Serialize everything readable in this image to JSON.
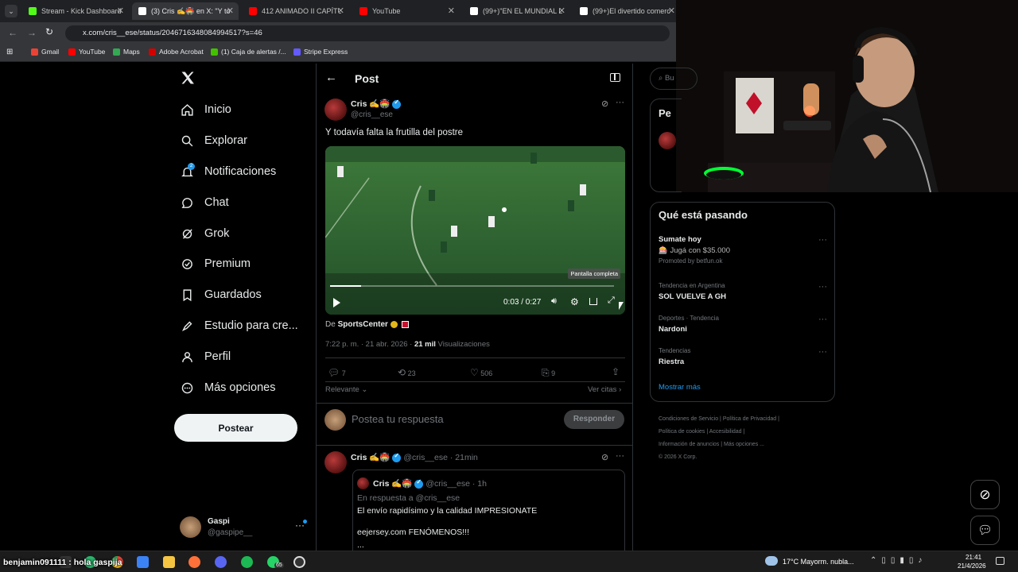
{
  "browser": {
    "tabs": [
      {
        "title": "Stream - Kick Dashboard",
        "color": "#53fc18"
      },
      {
        "title": "(3) Cris ✍️🏟️ en X: \"Y tod",
        "color": "#ffffff"
      },
      {
        "title": "412 ANIMADO II CAPÍTUL",
        "color": "#ff0000"
      },
      {
        "title": "YouTube",
        "color": "#ff0000"
      },
      {
        "title": "(99+)\"EN EL MUNDIAL LE",
        "color": "#ffffff"
      },
      {
        "title": "(99+)El divertido comerc",
        "color": "#ffffff"
      }
    ],
    "url": "x.com/cris__ese/status/2046716348084994517?s=46",
    "bookmarks": [
      {
        "label": "Gmail",
        "color": "#ea4335"
      },
      {
        "label": "YouTube",
        "color": "#ff0000"
      },
      {
        "label": "Maps",
        "color": "#34a853"
      },
      {
        "label": "Adobe Acrobat",
        "color": "#d40000"
      },
      {
        "label": "(1) Caja de alertas /...",
        "color": "#43c000"
      },
      {
        "label": "Stripe Express",
        "color": "#635bff"
      }
    ]
  },
  "nav": {
    "items": [
      {
        "label": "Inicio",
        "icon": "home-icon"
      },
      {
        "label": "Explorar",
        "icon": "search-icon"
      },
      {
        "label": "Notificaciones",
        "icon": "bell-icon",
        "badge": "2"
      },
      {
        "label": "Chat",
        "icon": "chat-icon"
      },
      {
        "label": "Grok",
        "icon": "grok-icon"
      },
      {
        "label": "Premium",
        "icon": "premium-icon"
      },
      {
        "label": "Guardados",
        "icon": "bookmark-icon"
      },
      {
        "label": "Estudio para cre...",
        "icon": "rocket-icon"
      },
      {
        "label": "Perfil",
        "icon": "person-icon"
      },
      {
        "label": "Más opciones",
        "icon": "more-icon"
      }
    ],
    "post_button": "Postear",
    "account": {
      "name": "Gaspi",
      "handle": "@gaspipe__"
    }
  },
  "post": {
    "header_title": "Post",
    "author": "Cris ✍️🏟️",
    "handle": "@cris__ese",
    "text": "Y todavía falta la frutilla del postre",
    "video": {
      "time": "0:03 / 0:27",
      "tooltip": "Pantalla completa",
      "progress": 0.11
    },
    "source_prefix": "De ",
    "source": "SportsCenter",
    "meta": "7:22 p. m. · 21 abr. 2026 · ",
    "views_count": "21 mil",
    "views_label": " Visualizaciones",
    "stats": {
      "replies": "7",
      "reposts": "23",
      "likes": "506",
      "bookmarks": "9"
    },
    "sort": "Relevante",
    "quotes_link": "Ver citas",
    "reply_placeholder": "Postea tu respuesta",
    "reply_button": "Responder"
  },
  "reply": {
    "author": "Cris ✍️🏟️",
    "handle": "@cris__ese",
    "time": "· 21min",
    "quoted": {
      "author": "Cris ✍️🏟️",
      "handle": "@cris__ese",
      "time": "· 1h",
      "in_reply": "En respuesta a @cris__ese",
      "line1": "El envío rapidísimo y la calidad IMPRESIONATE",
      "line2": "eejersey.com FENÓMENOS!!!",
      "line3": "..."
    }
  },
  "sidebar": {
    "search_placeholder": "Bu",
    "premium_title_partial": "Pe",
    "trends_title": "Qué está pasando",
    "promo": {
      "title": "Sumate hoy",
      "line": "🎰 Jugá con $35.000",
      "promoted": "Promoted by betfun.ok"
    },
    "trends": [
      {
        "context": "Tendencia en Argentina",
        "name": "SOL VUELVE A GH"
      },
      {
        "context": "Deportes · Tendencia",
        "name": "Nardoni"
      },
      {
        "context": "Tendencias",
        "name": "Riestra"
      }
    ],
    "show_more": "Mostrar más",
    "footer": [
      "Condiciones de Servicio",
      "Política de Privacidad",
      "Política de cookies",
      "Accesibilidad",
      "Información de anuncios",
      "Más opciones ...",
      "© 2026 X Corp."
    ]
  },
  "overlay_chat": "benjamin091111 : hola gaspija",
  "taskbar": {
    "weather": "17°C  Mayorm. nubla...",
    "time": "21:41",
    "date": "21/4/2026",
    "badge": "65"
  }
}
